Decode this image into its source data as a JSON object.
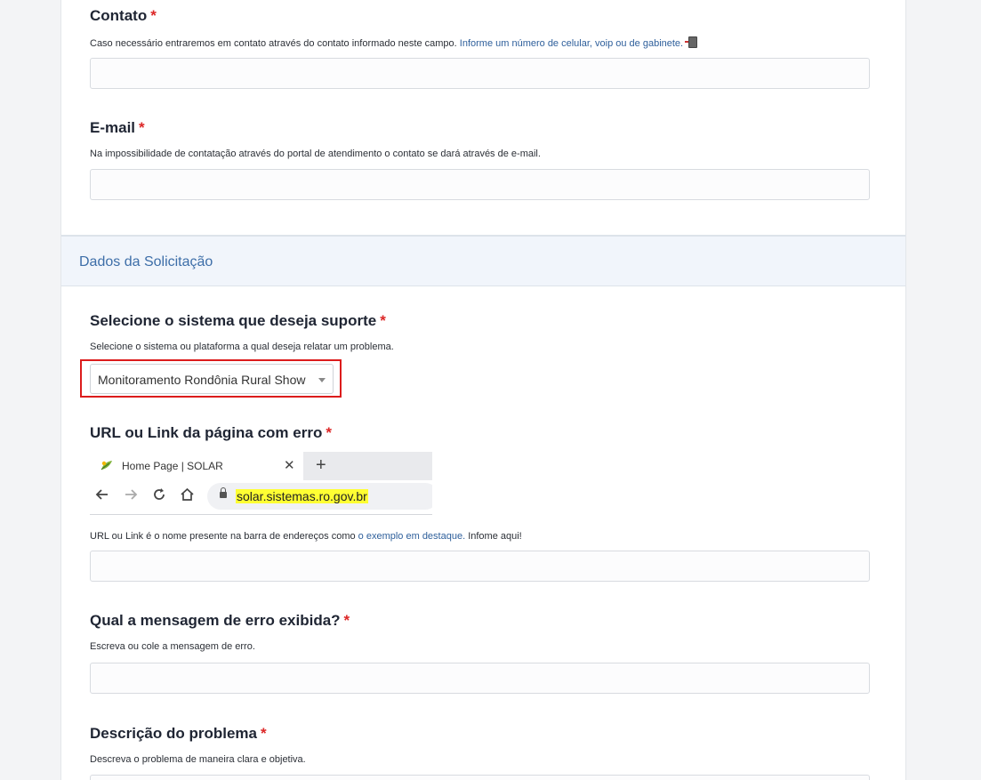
{
  "contact": {
    "label": "Contato",
    "required": "*",
    "help_text": "Caso necessário entraremos em contato através do contato informado neste campo. ",
    "help_link": "Informe um número de celular, voip ou de gabinete.",
    "icon": "phone-icon",
    "value": ""
  },
  "email": {
    "label": "E-mail",
    "required": "*",
    "help_text": "Na impossibilidade de contatação através do portal de atendimento o contato se dará através de e-mail.",
    "value": ""
  },
  "section": {
    "title": "Dados da Solicitação"
  },
  "system": {
    "label": "Selecione o sistema que deseja suporte",
    "required": "*",
    "help_text": "Selecione o sistema ou plataforma a qual deseja relatar um problema.",
    "selected": "Monitoramento Rondônia Rural Show"
  },
  "url": {
    "label": "URL ou Link da página com erro",
    "required": "*",
    "browser_example": {
      "tab_title": "Home Page | SOLAR",
      "tab_close": "✕",
      "new_tab": "+",
      "address": "solar.sistemas.ro.gov.br"
    },
    "help_text_before": "URL ou Link é o nome presente na barra de endereços como ",
    "help_link": "o exemplo em destaque.",
    "help_text_after": " Infome aqui!",
    "value": ""
  },
  "error_message": {
    "label": "Qual a mensagem de erro exibida?",
    "required": "*",
    "help_text": "Escreva ou cole a mensagem de erro.",
    "value": ""
  },
  "description": {
    "label": "Descrição do problema",
    "required": "*",
    "help_text": "Descreva o problema de maneira clara e objetiva."
  },
  "colors": {
    "required": "#dc2626",
    "link": "#2e5f9b",
    "section_title": "#3d6ea8",
    "highlight": "#dc1c1c",
    "url_highlight": "#ffff33"
  }
}
